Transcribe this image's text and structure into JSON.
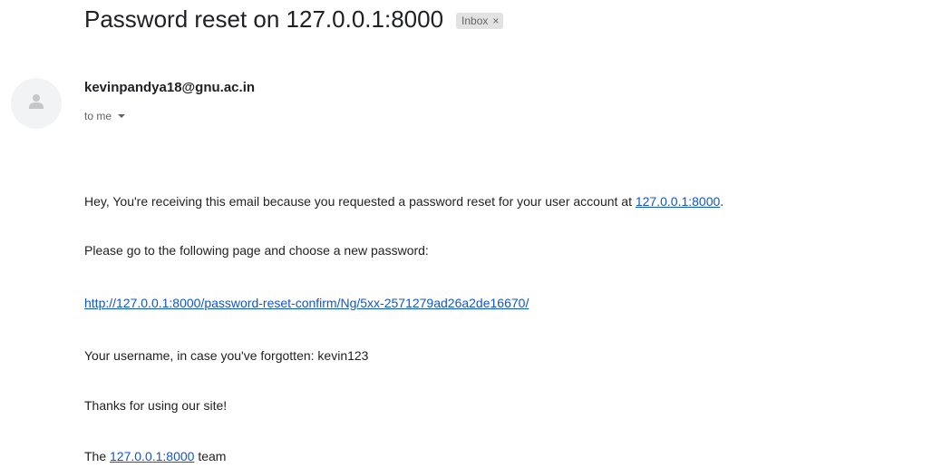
{
  "email": {
    "subject": "Password reset on 127.0.0.1:8000",
    "label": "Inbox",
    "label_remove_glyph": "×",
    "sender": "kevinpandya18@gnu.ac.in",
    "recipient": "to me",
    "body": {
      "line1_text": "Hey, You're receiving this email because you requested a password reset for your user account at ",
      "line1_link": "127.0.0.1:8000",
      "line1_end": ".",
      "line2": "Please go to the following page and choose a new password:",
      "reset_link": "http://127.0.0.1:8000/password-reset-confirm/Ng/5xx-2571279ad26a2de16670/",
      "line4": "Your username, in case you've forgotten: kevin123",
      "line5": "Thanks for using our site!",
      "line6_prefix": "The ",
      "line6_link": "127.0.0.1:8000",
      "line6_suffix": " team"
    }
  },
  "icons": {
    "avatar": "default-person-icon",
    "recipient_details": "caret-down-icon",
    "label_remove": "close-icon"
  },
  "colors": {
    "link": "#1155cc",
    "label_chip_bg": "#e2e2e2",
    "avatar_bg": "#f1f3f4"
  }
}
